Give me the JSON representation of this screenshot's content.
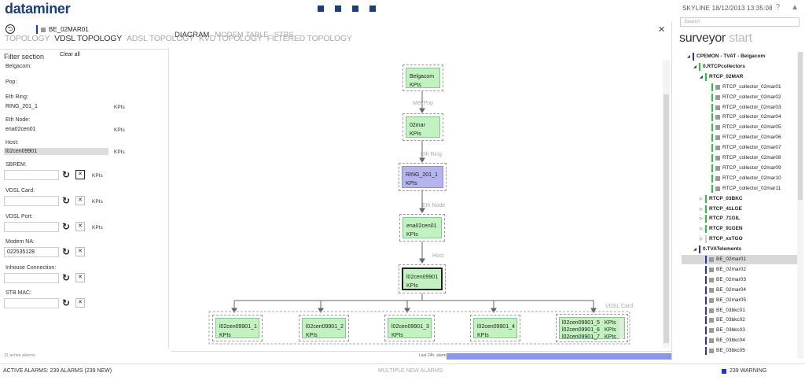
{
  "app": {
    "logo": "dataminer",
    "brand_color": "#1b3f7a"
  },
  "top": {
    "skyline": "SKYLINE  18/12/2013 13:35:08",
    "help": "?",
    "settings": "▲"
  },
  "card": {
    "element": "BE_02MAR01",
    "close": "✕",
    "back": "⮌"
  },
  "tabs": [
    "TOPOLOGY",
    "VDSL TOPOLOGY",
    "ADSL TOPOLOGY",
    "KVD TOPOLOGY",
    "FILTERED TOPOLOGY"
  ],
  "active_tab": "VDSL TOPOLOGY",
  "filter": {
    "title": "Filter section",
    "clear_all": "Clear all",
    "belgacom": "Belgacom:",
    "pop": "Pop:",
    "eth_ring_label": "Eth Ring:",
    "eth_ring_value": "RING_201_1",
    "eth_node_label": "Eth Node:",
    "eth_node_value": "ena02cen01",
    "host_label": "Host:",
    "host_value": "l02cen09901",
    "kpis": "KPIs",
    "sbrem_label": "SBREM:",
    "vdsl_card_label": "VDSL Card:",
    "vdsl_port_label": "VDSL Port:",
    "modem_na_label": "Modem NA:",
    "modem_na_value": "022535128",
    "inhouse_label": "Inhouse Connection:",
    "stb_mac_label": "STB MAC:",
    "active_alarms": "11 active alarms"
  },
  "subtabs": [
    "DIAGRAM",
    "MODEM TABLE",
    "STBS"
  ],
  "diagram": {
    "nodes": {
      "belgacom": "Belgacom",
      "mar02": "02mar",
      "ring": "RING_201_1",
      "ena": "ena02cen01",
      "host": "l02cen09901",
      "c1": "l02cen09901_1",
      "c2": "l02cen09901_2",
      "c3": "l02cen09901_3",
      "c4": "l02cen09901_4",
      "c5": "l02cen09901_5",
      "c6": "l02cen09901_6",
      "c7": "l02cen09901_7"
    },
    "kpis": "KPIs",
    "group_labels": {
      "metro_pop": "Met/Pop",
      "eth_ring": "Eth Ring",
      "eth_node": "Eth Node",
      "host": "Host",
      "vdsl_card": "VDSL Card"
    },
    "footer_label": "Last 24h. alarm state"
  },
  "surveyor": {
    "search_placeholder": "Search",
    "title": "surveyor",
    "start": "start",
    "tree": [
      {
        "label": "CPEMON - TVAT - Belgacom",
        "bold": true,
        "indent": 0,
        "toggle": "◢",
        "bar": "#2233cc"
      },
      {
        "label": "0.RTCPcollectors",
        "bold": true,
        "indent": 1,
        "toggle": "◢",
        "bar": "#22cc33"
      },
      {
        "label": "RTCP_02MAR",
        "bold": true,
        "indent": 2,
        "toggle": "◢",
        "bar": "#22cc33"
      },
      {
        "label": "RTCP_collector_02mar01",
        "indent": 3,
        "elem": true,
        "bar": "#22cc33"
      },
      {
        "label": "RTCP_collector_02mar02",
        "indent": 3,
        "elem": true,
        "bar": "#22cc33"
      },
      {
        "label": "RTCP_collector_02mar03",
        "indent": 3,
        "elem": true,
        "bar": "#22cc33"
      },
      {
        "label": "RTCP_collector_02mar04",
        "indent": 3,
        "elem": true,
        "bar": "#22cc33"
      },
      {
        "label": "RTCP_collector_02mar05",
        "indent": 3,
        "elem": true,
        "bar": "#22cc33"
      },
      {
        "label": "RTCP_collector_02mar06",
        "indent": 3,
        "elem": true,
        "bar": "#22cc33"
      },
      {
        "label": "RTCP_collector_02mar07",
        "indent": 3,
        "elem": true,
        "bar": "#22cc33"
      },
      {
        "label": "RTCP_collector_02mar08",
        "indent": 3,
        "elem": true,
        "bar": "#22cc33"
      },
      {
        "label": "RTCP_collector_02mar09",
        "indent": 3,
        "elem": true,
        "bar": "#22cc33"
      },
      {
        "label": "RTCP_collector_02mar10",
        "indent": 3,
        "elem": true,
        "bar": "#22cc33"
      },
      {
        "label": "RTCP_collector_02mar11",
        "indent": 3,
        "elem": true,
        "bar": "#22cc33"
      },
      {
        "label": "RTCP_03BKC",
        "bold": true,
        "indent": 2,
        "toggle": "▷",
        "bar": "#22cc33"
      },
      {
        "label": "RTCP_41LGE",
        "bold": true,
        "indent": 2,
        "toggle": "▷",
        "bar": "#22cc33"
      },
      {
        "label": "RTCP_71GIL",
        "bold": true,
        "indent": 2,
        "toggle": "▷",
        "bar": "#22cc33"
      },
      {
        "label": "RTCP_91GEN",
        "bold": true,
        "indent": 2,
        "toggle": "▷",
        "bar": "#22cc33"
      },
      {
        "label": "RTCP_xxTGO",
        "bold": true,
        "indent": 2,
        "toggle": "▷",
        "bar": "#cccccc"
      },
      {
        "label": "0.TVATelements",
        "bold": true,
        "indent": 1,
        "toggle": "◢",
        "bar": "#2233cc"
      },
      {
        "label": "BE_02mar01",
        "indent": 2,
        "elem": true,
        "bar": "#2233cc",
        "hl": true
      },
      {
        "label": "BE_02mar02",
        "indent": 2,
        "elem": true,
        "bar": "#2233cc"
      },
      {
        "label": "BE_02mar03",
        "indent": 2,
        "elem": true,
        "bar": "#2233cc"
      },
      {
        "label": "BE_02mar04",
        "indent": 2,
        "elem": true,
        "bar": "#2233cc"
      },
      {
        "label": "BE_02mar05",
        "indent": 2,
        "elem": true,
        "bar": "#2233cc"
      },
      {
        "label": "BE_03bkc01",
        "indent": 2,
        "elem": true,
        "bar": "#2233cc"
      },
      {
        "label": "BE_03bkc02",
        "indent": 2,
        "elem": true,
        "bar": "#2233cc"
      },
      {
        "label": "BE_03bkc03",
        "indent": 2,
        "elem": true,
        "bar": "#2233cc"
      },
      {
        "label": "BE_03bkc04",
        "indent": 2,
        "elem": true,
        "bar": "#2233cc"
      },
      {
        "label": "BE_03bkc05",
        "indent": 2,
        "elem": true,
        "bar": "#2233cc"
      }
    ]
  },
  "status": {
    "left": "ACTIVE ALARMS: 239 ALARMS (239 NEW)",
    "mid": "MULTIPLE NEW ALARMS",
    "right": "239 WARNING"
  }
}
